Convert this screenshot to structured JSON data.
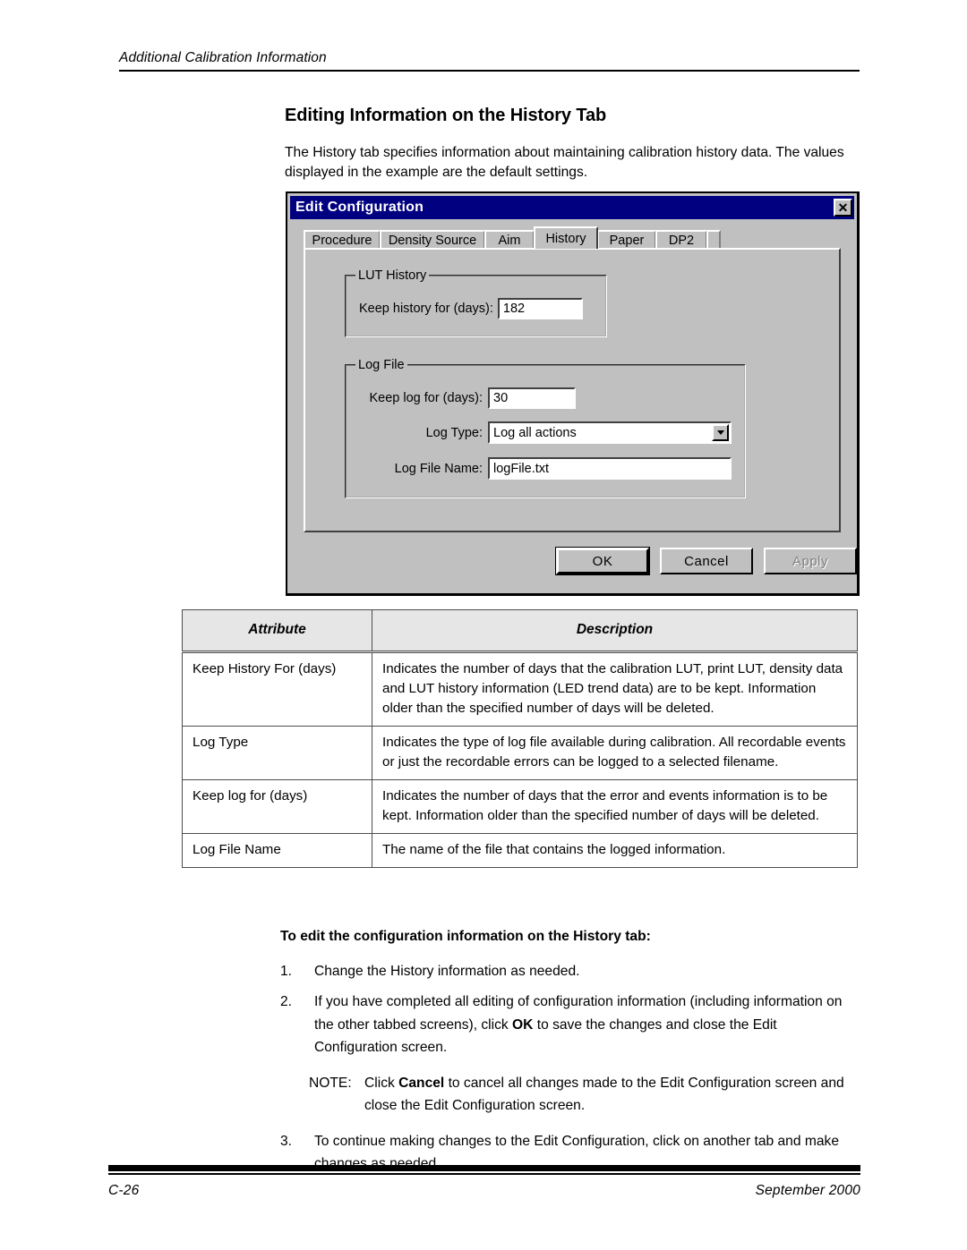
{
  "running_header": {
    "text": "Additional Calibration Information"
  },
  "page_title": "Editing Information on the History Tab",
  "intro": "The History tab specifies information about maintaining calibration history data. The values displayed in the example are the default settings.",
  "dialog": {
    "title": "Edit Configuration",
    "close_icon": "✕",
    "tabs": [
      {
        "label": "Procedure",
        "selected": false
      },
      {
        "label": "Density Source",
        "selected": false
      },
      {
        "label": "Aim",
        "selected": false
      },
      {
        "label": "History",
        "selected": true
      },
      {
        "label": "Paper",
        "selected": false
      },
      {
        "label": "DP2",
        "selected": false
      }
    ],
    "lut_history": {
      "group_title": "LUT History",
      "keep_history_label": "Keep history for (days):",
      "keep_history_value": "182"
    },
    "log_file": {
      "group_title": "Log File",
      "keep_log_label": "Keep log for (days):",
      "keep_log_value": "30",
      "log_type_label": "Log Type:",
      "log_type_value": "Log all actions",
      "log_file_name_label": "Log File Name:",
      "log_file_name_value": "logFile.txt"
    },
    "buttons": {
      "ok": "OK",
      "cancel": "Cancel",
      "apply": "Apply"
    },
    "colors": {
      "titlebar": "#000080",
      "face": "#c0c0c0",
      "field": "#ffffff",
      "disabled_text": "#808080"
    }
  },
  "table": {
    "headers": [
      "Attribute",
      "Description"
    ],
    "rows": [
      {
        "attribute": "Keep History For (days)",
        "description": "Indicates the number of days that the calibration LUT, print LUT, density data and LUT history information (LED trend data) are to be kept. Information older than the specified number of days will be deleted."
      },
      {
        "attribute": "Log Type",
        "description": "Indicates the type of log file available during calibration. All recordable events or just the recordable errors can be logged to a selected filename."
      },
      {
        "attribute": "Keep log for (days)",
        "description": "Indicates the number of days that the error and events information is to be kept. Information older than the specified number of days will be deleted."
      },
      {
        "attribute": "Log File Name",
        "description": "The name of the file that contains the logged information."
      }
    ]
  },
  "procedure": {
    "title": "To edit the configuration information on the History tab:",
    "step1_num": "1.",
    "step1_text": "Change the History information as needed.",
    "step2_num": "2.",
    "step2_a": "If you have completed all editing of configuration information (including information on the other tabbed screens), click ",
    "step2_bold": "OK",
    "step2_b": " to save the changes and close the Edit Configuration screen.",
    "note_label": "NOTE:",
    "note_a": "Click ",
    "note_bold": "Cancel",
    "note_b": " to cancel all changes made to the Edit Configuration screen and close the Edit Configuration screen.",
    "step3_num": "3.",
    "step3_text": "To continue making changes to the Edit Configuration, click on another tab and make changes as needed."
  },
  "footer": {
    "page_number": "C-26",
    "date": "September 2000"
  }
}
